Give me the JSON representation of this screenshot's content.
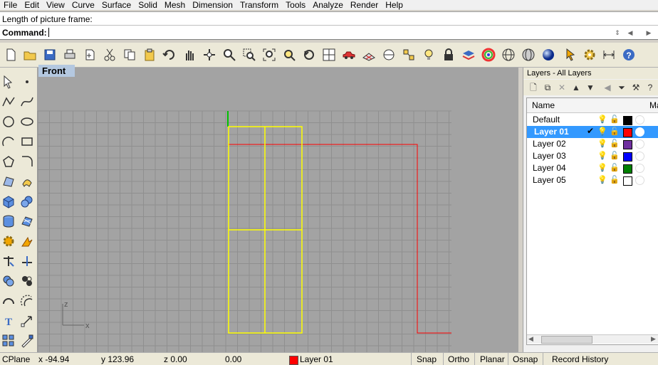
{
  "menu": [
    "File",
    "Edit",
    "View",
    "Curve",
    "Surface",
    "Solid",
    "Mesh",
    "Dimension",
    "Transform",
    "Tools",
    "Analyze",
    "Render",
    "Help"
  ],
  "command": {
    "history": "Length of picture frame:",
    "prompt": "Command:"
  },
  "viewport": {
    "title": "Front",
    "axis_z": "z",
    "axis_x": "x"
  },
  "layers_panel": {
    "title": "Layers - All Layers",
    "columns": {
      "name": "Name",
      "material": "Ma"
    },
    "layers": [
      {
        "name": "Default",
        "color": "#000000",
        "selected": false,
        "current": false
      },
      {
        "name": "Layer 01",
        "color": "#ff0000",
        "selected": true,
        "current": true
      },
      {
        "name": "Layer 02",
        "color": "#7030a0",
        "selected": false,
        "current": false
      },
      {
        "name": "Layer 03",
        "color": "#0000ff",
        "selected": false,
        "current": false
      },
      {
        "name": "Layer 04",
        "color": "#008000",
        "selected": false,
        "current": false
      },
      {
        "name": "Layer 05",
        "color": "#ffffff",
        "selected": false,
        "current": false
      }
    ]
  },
  "status": {
    "cplane": "CPlane",
    "x": "x -94.94",
    "y": "y 123.96",
    "z": "z 0.00",
    "dist": "0.00",
    "layer": "Layer 01",
    "layer_color": "#ff0000",
    "snap": "Snap",
    "ortho": "Ortho",
    "planar": "Planar",
    "osnap": "Osnap",
    "record": "Record History"
  },
  "colors": {
    "grid_line": "#8f8f8f",
    "grid_major": "#7a7a7a",
    "frame_yellow": "#ffff00",
    "frame_red": "#ff0000",
    "axis_green": "#00c000"
  },
  "toolbar_icons": [
    "new-icon",
    "open-icon",
    "save-icon",
    "print-icon",
    "import-icon",
    "cut-icon",
    "copy-icon",
    "paste-icon",
    "undo-icon",
    "pan-icon",
    "rotate-view-icon",
    "zoom-dynamic-icon",
    "zoom-window-icon",
    "zoom-extents-icon",
    "zoom-selected-icon",
    "undo-view-icon",
    "four-viewports-icon",
    "car-icon",
    "grid-options-icon",
    "cplane-icon",
    "snap-icon",
    "light-icon",
    "lock-icon",
    "layer-icon",
    "color-wheel-icon",
    "wireframe-icon",
    "ghosted-icon",
    "render-sphere-icon",
    "select-icon",
    "settings-gear-icon",
    "dimension-icon",
    "help-icon"
  ]
}
